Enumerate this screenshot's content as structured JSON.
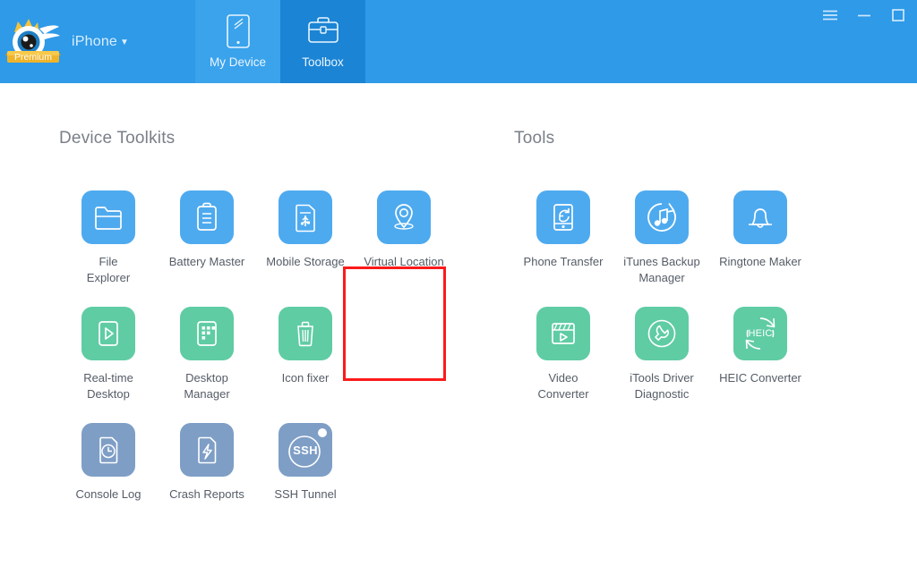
{
  "header": {
    "device_label": "iPhone",
    "device_caret": "▼",
    "premium_badge": "Premium",
    "logo_icon": "itools-bird-logo-icon",
    "tabs": [
      {
        "label": "My Device",
        "icon": "tablet-icon",
        "active": false
      },
      {
        "label": "Toolbox",
        "icon": "briefcase-icon",
        "active": true
      }
    ],
    "window_controls": [
      {
        "name": "menu-button",
        "icon": "hamburger-icon"
      },
      {
        "name": "minimize-button",
        "icon": "minimize-icon"
      },
      {
        "name": "maximize-button",
        "icon": "maximize-icon"
      }
    ]
  },
  "colors": {
    "header_bg": "#2e9ae8",
    "tab_active_bg": "#1b84d4",
    "tab_inactive_bg": "#3aa3ec",
    "tile_blue": "#4eaaef",
    "tile_green": "#5fcca4",
    "tile_slate": "#7e9ec6",
    "highlight_border": "#fc1a1a",
    "section_title": "#7a7f88",
    "tile_label": "#555c66"
  },
  "sections": [
    {
      "title": "Device Toolkits",
      "rows": [
        [
          {
            "label": "File\nExplorer",
            "icon": "folder-icon",
            "color": "blue"
          },
          {
            "label": "Battery Master",
            "icon": "clipboard-icon",
            "color": "blue"
          },
          {
            "label": "Mobile Storage",
            "icon": "usb-card-icon",
            "color": "blue"
          },
          {
            "label": "Virtual Location",
            "icon": "map-pin-icon",
            "color": "blue",
            "highlighted": true
          }
        ],
        [
          {
            "label": "Real-time\nDesktop",
            "icon": "play-screen-icon",
            "color": "green"
          },
          {
            "label": "Desktop\nManager",
            "icon": "app-grid-icon",
            "color": "green"
          },
          {
            "label": "Icon fixer",
            "icon": "trash-icon",
            "color": "green"
          }
        ],
        [
          {
            "label": "Console Log",
            "icon": "clock-document-icon",
            "color": "slate"
          },
          {
            "label": "Crash Reports",
            "icon": "bolt-document-icon",
            "color": "slate"
          },
          {
            "label": "SSH Tunnel",
            "icon": "ssh-circle-icon",
            "color": "slate",
            "badge_dot": true
          }
        ]
      ]
    },
    {
      "title": "Tools",
      "rows": [
        [
          {
            "label": "Phone Transfer",
            "icon": "phone-transfer-icon",
            "color": "blue"
          },
          {
            "label": "iTunes Backup\nManager",
            "icon": "itunes-sync-icon",
            "color": "blue"
          },
          {
            "label": "Ringtone Maker",
            "icon": "bell-icon",
            "color": "blue"
          }
        ],
        [
          {
            "label": "Video\nConverter",
            "icon": "film-play-icon",
            "color": "green"
          },
          {
            "label": "iTools Driver\nDiagnostic",
            "icon": "wrench-icon",
            "color": "green"
          },
          {
            "label": "HEIC Converter",
            "icon": "heic-refresh-icon",
            "color": "green",
            "inner_text": "HEIC"
          }
        ]
      ]
    }
  ]
}
